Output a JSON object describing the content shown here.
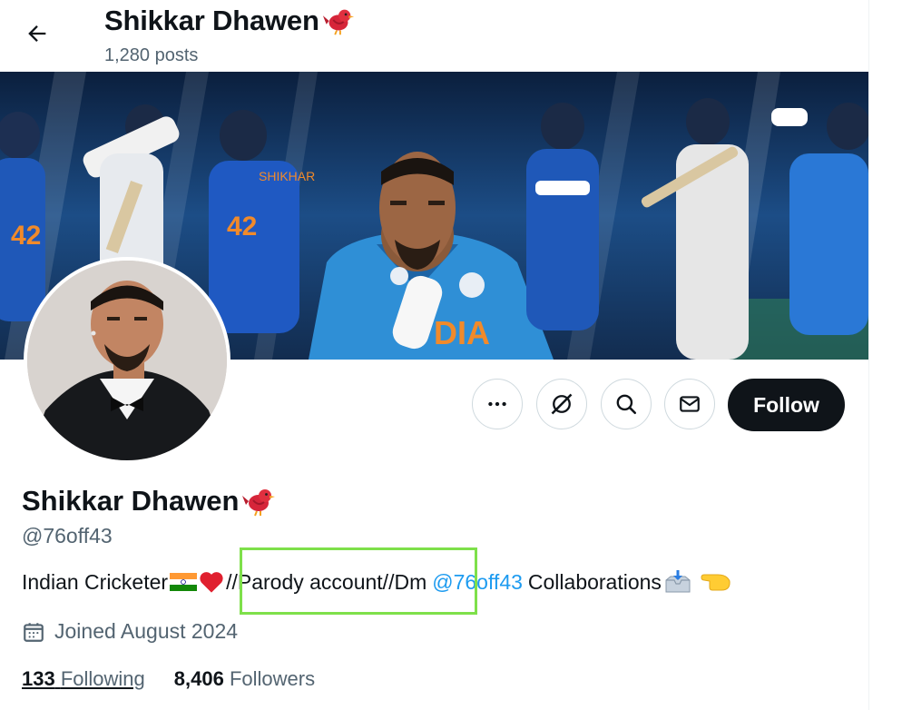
{
  "header": {
    "display_name": "Shikkar Dhawen",
    "posts_count": "1,280 posts"
  },
  "banner": {
    "jersey_text": "DIA",
    "name_text": "SHIKHAR",
    "number_text": "42"
  },
  "actions": {
    "follow_label": "Follow"
  },
  "profile": {
    "display_name": "Shikkar Dhawen",
    "handle": "@76off43",
    "bio": {
      "part1": "Indian Cricketer",
      "part2": "//Parody account//Dm",
      "mention": "@76off43",
      "part3": "Collaborations"
    },
    "joined": "Joined August 2024",
    "following_count": "133",
    "following_label": "Following",
    "followers_count": "8,406",
    "followers_label": "Followers"
  },
  "colors": {
    "accent": "#1d9bf0",
    "highlight": "#7ee04a",
    "follow_bg": "#0f1419"
  }
}
